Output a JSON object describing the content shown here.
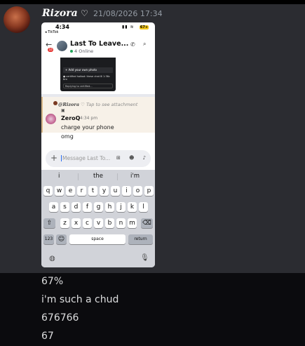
{
  "message": {
    "username": "Rizora",
    "heart": "♡",
    "timestamp": "21/08/2026 17:34"
  },
  "phone": {
    "status": {
      "time": "4:34",
      "back_app": "◂ TikTok",
      "icons": "▮▮ ≋",
      "battery": "67+"
    },
    "channel": {
      "back": "←",
      "badge": "10",
      "title": "Last To Leave...",
      "online": "4 Online",
      "call_icon": "phone-icon",
      "search_icon": "search-icon"
    },
    "embed": {
      "add_photo": "+ Add your own photo",
      "line1": "● certified hotbot: ",
      "line1b": "these chat",
      "line2": "bro",
      "corner": "⊞ 1:36c",
      "bar": "Replying to certified..."
    },
    "reply": {
      "name": "@Rizora",
      "note": "♡ Tap to see attachment"
    },
    "message": {
      "author": "ZeroQ",
      "time": "4:34 pm",
      "lines": [
        "charge your phone",
        "omg"
      ]
    },
    "input": {
      "plus": "+",
      "placeholder": "Message Last To...",
      "icons": "⊞ ☻ ♪"
    },
    "keyboard": {
      "suggestions": [
        "i",
        "the",
        "i'm"
      ],
      "row1": [
        "q",
        "w",
        "e",
        "r",
        "t",
        "y",
        "u",
        "i",
        "o",
        "p"
      ],
      "row2": [
        "a",
        "s",
        "d",
        "f",
        "g",
        "h",
        "j",
        "k",
        "l"
      ],
      "row3": [
        "z",
        "x",
        "c",
        "v",
        "b",
        "n",
        "m"
      ],
      "shift": "⇧",
      "backspace": "⌫",
      "numbers": "123",
      "emoji": "☺",
      "space": "space",
      "return": "return",
      "globe": "◍",
      "mic": "🎙"
    }
  },
  "lower_messages": [
    "67%",
    "i'm such a chud",
    "676766",
    "67"
  ]
}
